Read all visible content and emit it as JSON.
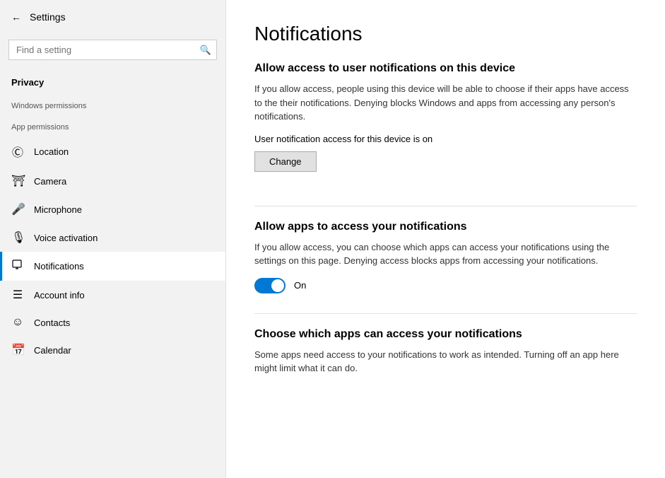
{
  "sidebar": {
    "back_label": "←",
    "title": "Settings",
    "search_placeholder": "Find a setting",
    "privacy_label": "Privacy",
    "windows_permissions_label": "Windows permissions",
    "app_permissions_label": "App permissions",
    "nav_items": [
      {
        "id": "location",
        "label": "Location",
        "icon": "person"
      },
      {
        "id": "camera",
        "label": "Camera",
        "icon": "camera"
      },
      {
        "id": "microphone",
        "label": "Microphone",
        "icon": "mic"
      },
      {
        "id": "voice-activation",
        "label": "Voice activation",
        "icon": "mic2"
      },
      {
        "id": "notifications",
        "label": "Notifications",
        "icon": "bell",
        "active": true
      },
      {
        "id": "account-info",
        "label": "Account info",
        "icon": "person2"
      },
      {
        "id": "contacts",
        "label": "Contacts",
        "icon": "contacts"
      },
      {
        "id": "calendar",
        "label": "Calendar",
        "icon": "calendar"
      }
    ]
  },
  "main": {
    "page_title": "Notifications",
    "section1": {
      "heading": "Allow access to user notifications on this device",
      "desc": "If you allow access, people using this device will be able to choose if their apps have access to the their notifications. Denying blocks Windows and apps from accessing any person's notifications.",
      "status": "User notification access for this device is on",
      "change_btn": "Change"
    },
    "section2": {
      "heading": "Allow apps to access your notifications",
      "desc": "If you allow access, you can choose which apps can access your notifications using the settings on this page. Denying access blocks apps from accessing your notifications.",
      "toggle_state": "on",
      "toggle_label": "On"
    },
    "section3": {
      "heading": "Choose which apps can access your notifications",
      "desc": "Some apps need access to your notifications to work as intended. Turning off an app here might limit what it can do."
    }
  }
}
